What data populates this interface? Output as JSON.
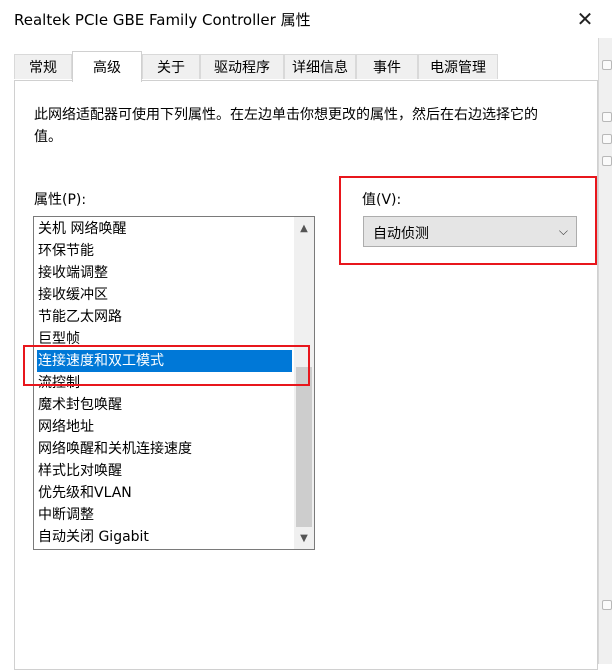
{
  "window": {
    "title": "Realtek PCIe GBE Family Controller 属性",
    "close_icon": "close-icon"
  },
  "tabs": [
    {
      "label": "常规",
      "active": false
    },
    {
      "label": "高级",
      "active": true
    },
    {
      "label": "关于",
      "active": false
    },
    {
      "label": "驱动程序",
      "active": false
    },
    {
      "label": "详细信息",
      "active": false
    },
    {
      "label": "事件",
      "active": false
    },
    {
      "label": "电源管理",
      "active": false
    }
  ],
  "advanced": {
    "description": "此网络适配器可使用下列属性。在左边单击你想更改的属性，然后在右边选择它的值。",
    "property_label": "属性(P):",
    "value_label": "值(V):",
    "selected_value": "自动侦测",
    "properties": [
      "关机 网络唤醒",
      "环保节能",
      "接收端调整",
      "接收缓冲区",
      "节能乙太网路",
      "巨型帧",
      "连接速度和双工模式",
      "流控制",
      "魔术封包唤醒",
      "网络地址",
      "网络唤醒和关机连接速度",
      "样式比对唤醒",
      "优先级和VLAN",
      "中断调整",
      "自动关闭 Gigabit"
    ],
    "selected_property": "连接速度和双工模式"
  },
  "highlight_color": "#e8161c",
  "selection_color": "#0078d7"
}
